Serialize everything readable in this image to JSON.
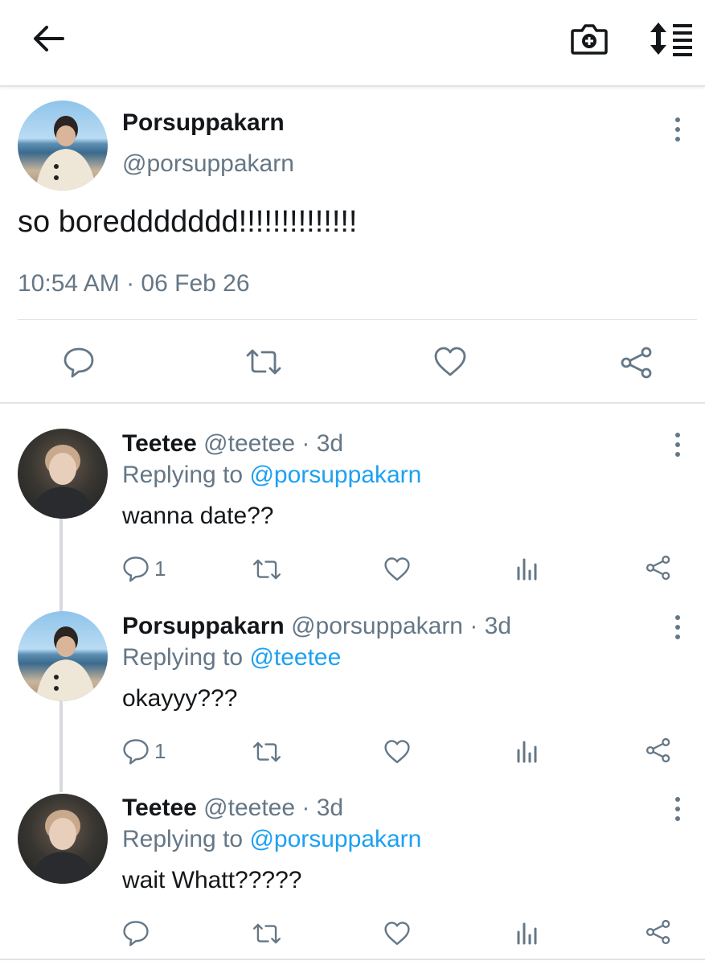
{
  "topbar": {
    "back_icon": "arrow-left-icon",
    "camera_icon": "camera-plus-icon",
    "sort_icon": "sort-list-icon"
  },
  "main_tweet": {
    "name": "Porsuppakarn",
    "handle": "@porsuppakarn",
    "text": "so boreddddddd!!!!!!!!!!!!!!",
    "timestamp": "10:54 AM · 06 Feb 26"
  },
  "replies": [
    {
      "name": "Teetee",
      "handle_time": "@teetee · 3d",
      "replying_prefix": "Replying to",
      "replying_to": "@porsuppakarn",
      "text": "wanna date??",
      "reply_count": "1"
    },
    {
      "name": "Porsuppakarn",
      "handle_time": "@porsuppakarn · 3d",
      "replying_prefix": "Replying to",
      "replying_to": "@teetee",
      "text": "okayyy???",
      "reply_count": "1"
    },
    {
      "name": "Teetee",
      "handle_time": "@teetee · 3d",
      "replying_prefix": "Replying to",
      "replying_to": "@porsuppakarn",
      "text": "wait Whatt?????",
      "reply_count": ""
    }
  ],
  "colors": {
    "text": "#14171a",
    "muted": "#657786",
    "link": "#1da1f2",
    "divider": "#e1e4e7"
  }
}
